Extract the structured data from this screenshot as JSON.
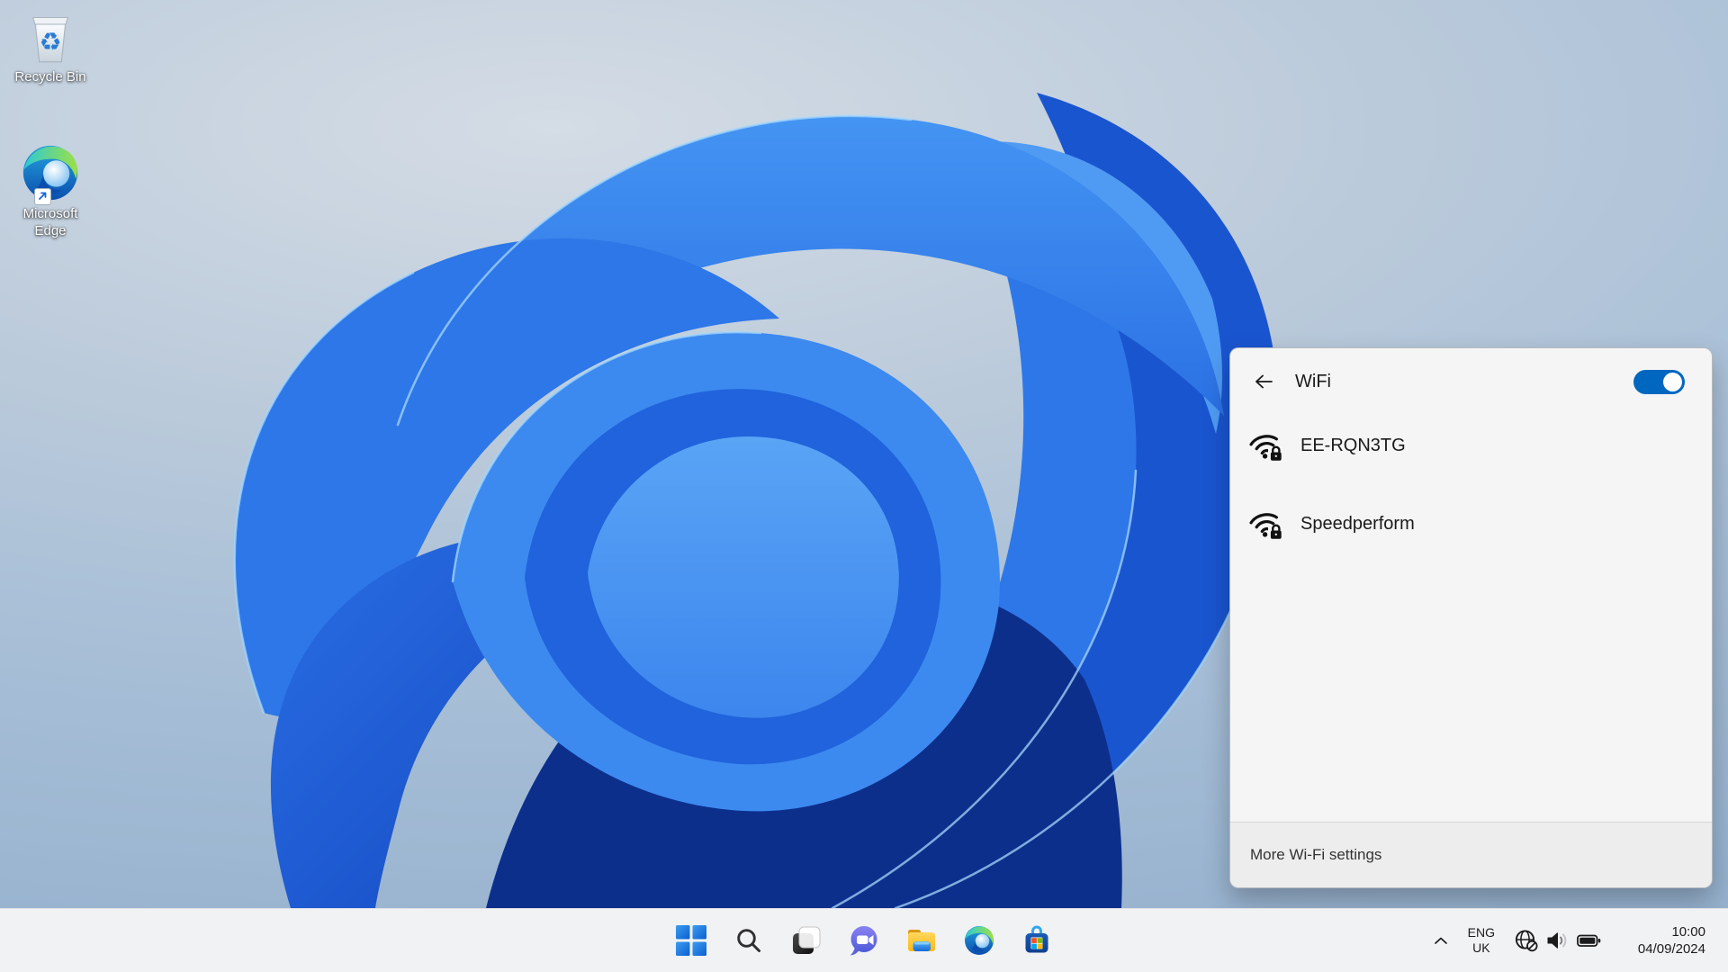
{
  "wallpaper": {
    "description": "Windows 11 blue bloom abstract ribbons",
    "background": "#a8bfd7",
    "palette": [
      "#0d2f8c",
      "#1a55d0",
      "#2e77e8",
      "#3585ee",
      "#3c8af0",
      "#2063dc",
      "#4f9bf4",
      "#a6d8fb"
    ]
  },
  "desktop": {
    "icons": [
      {
        "label": "Recycle Bin",
        "icon": "recycle-bin"
      },
      {
        "line1": "Microsoft",
        "line2": "Edge",
        "icon": "edge-swirl-with-shortcut-arrow"
      }
    ]
  },
  "wifi_panel": {
    "title": "WiFi",
    "back_icon": "left-arrow",
    "toggle_on": true,
    "accent": "#0067c0",
    "networks": [
      {
        "name": "EE-RQN3TG",
        "secured": true,
        "icon": "wifi-signal-with-lock"
      },
      {
        "name": "Speedperform",
        "secured": true,
        "icon": "wifi-signal-with-lock"
      }
    ],
    "footer_label": "More Wi-Fi settings"
  },
  "taskbar": {
    "background": "#f1f2f4",
    "buttons": [
      {
        "name": "start",
        "icon": "windows-logo"
      },
      {
        "name": "search",
        "icon": "magnifier"
      },
      {
        "name": "task-view",
        "icon": "overlapping-squares"
      },
      {
        "name": "chat",
        "icon": "video-camera-bubble"
      },
      {
        "name": "file-explorer",
        "icon": "yellow-folder"
      },
      {
        "name": "edge-browser",
        "icon": "edge-swirl"
      },
      {
        "name": "microsoft-store",
        "icon": "shopping-bag-windows"
      }
    ],
    "tray": {
      "chevron_icon": "chevron-up",
      "language": {
        "line1": "ENG",
        "line2": "UK"
      },
      "status_icons": [
        "globe-no-internet",
        "speaker-volume",
        "battery-full"
      ],
      "clock": {
        "time": "10:00",
        "date": "04/09/2024"
      }
    }
  }
}
